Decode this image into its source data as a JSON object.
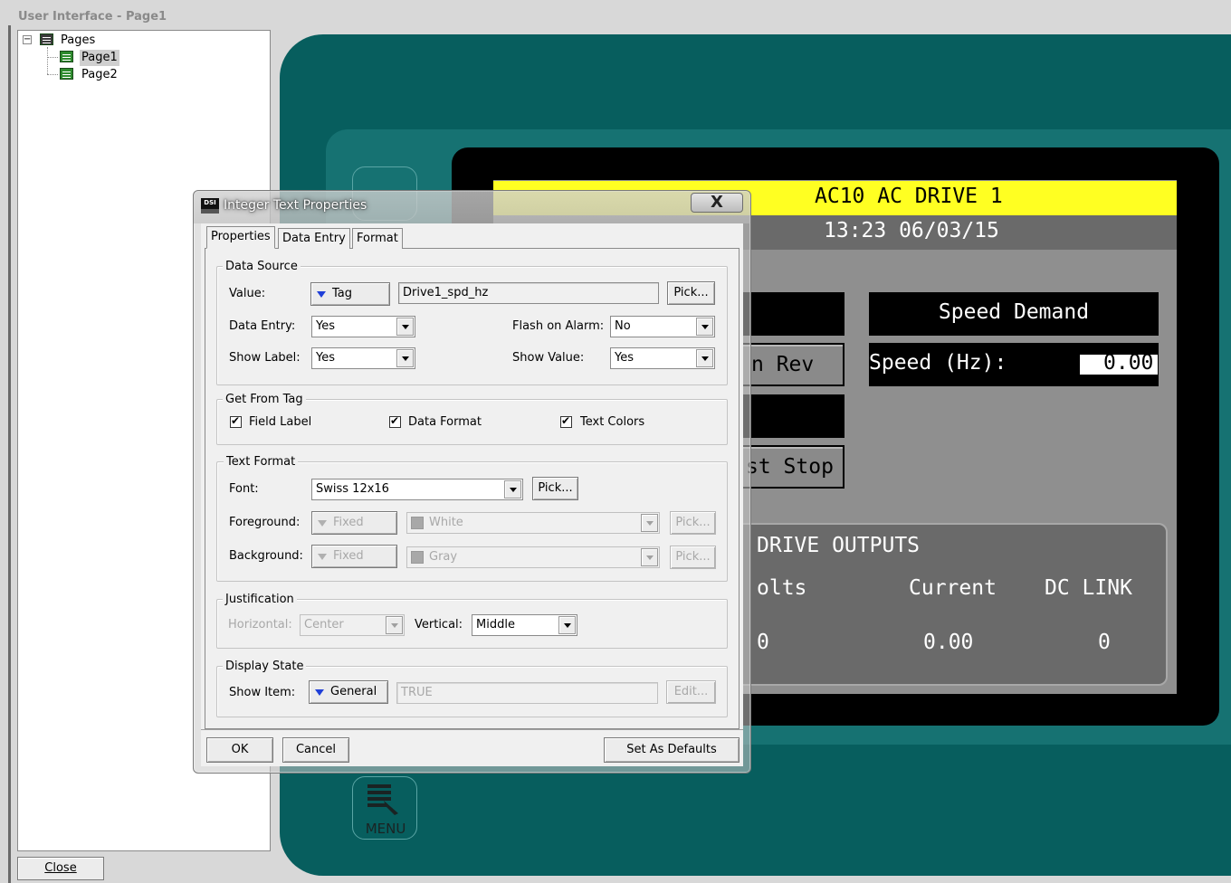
{
  "window": {
    "title": "User Interface - Page1",
    "close_label": "Close"
  },
  "tree": {
    "root": "Pages",
    "expander": "−",
    "items": [
      {
        "label": "Page1",
        "selected": true
      },
      {
        "label": "Page2",
        "selected": false
      }
    ]
  },
  "hmi": {
    "title": "AC10 AC DRIVE 1",
    "datetime": "13:23 06/03/15",
    "buttons": [
      "n Rev",
      "st Stop"
    ],
    "speed_demand": "Speed Demand",
    "speed_label": "Speed (Hz):",
    "speed_value": "0.00",
    "outputs_title": "DRIVE OUTPUTS",
    "outputs_headers": [
      "olts",
      "Current",
      "DC LINK"
    ],
    "outputs_values": [
      "0",
      "0.00",
      "0"
    ],
    "menu_label": "MENU",
    "colors": {
      "header": "#ffff22",
      "panel": "#075e5e"
    }
  },
  "dialog": {
    "title": "Integer Text Properties",
    "logo": "DSI",
    "close_glyph": "X",
    "tabs": [
      "Properties",
      "Data Entry",
      "Format"
    ],
    "data_source": {
      "title": "Data Source",
      "value_label": "Value:",
      "value_source": "Tag",
      "value": "Drive1_spd_hz",
      "pick": "Pick...",
      "data_entry_label": "Data Entry:",
      "data_entry": "Yes",
      "flash_label": "Flash on Alarm:",
      "flash": "No",
      "show_label_label": "Show Label:",
      "show_label": "Yes",
      "show_value_label": "Show Value:",
      "show_value": "Yes"
    },
    "get_from_tag": {
      "title": "Get From Tag",
      "field_label": "Field Label",
      "data_format": "Data Format",
      "text_colors": "Text Colors"
    },
    "text_format": {
      "title": "Text Format",
      "font_label": "Font:",
      "font": "Swiss 12x16",
      "pick": "Pick...",
      "fg_label": "Foreground:",
      "fg_source": "Fixed",
      "fg_color": "White",
      "bg_label": "Background:",
      "bg_source": "Fixed",
      "bg_color": "Gray"
    },
    "justification": {
      "title": "Justification",
      "horizontal_label": "Horizontal:",
      "horizontal": "Center",
      "vertical_label": "Vertical:",
      "vertical": "Middle"
    },
    "display_state": {
      "title": "Display State",
      "show_item_label": "Show Item:",
      "source": "General",
      "value": "TRUE",
      "edit": "Edit..."
    },
    "buttons": {
      "ok": "OK",
      "cancel": "Cancel",
      "defaults": "Set As Defaults"
    }
  }
}
